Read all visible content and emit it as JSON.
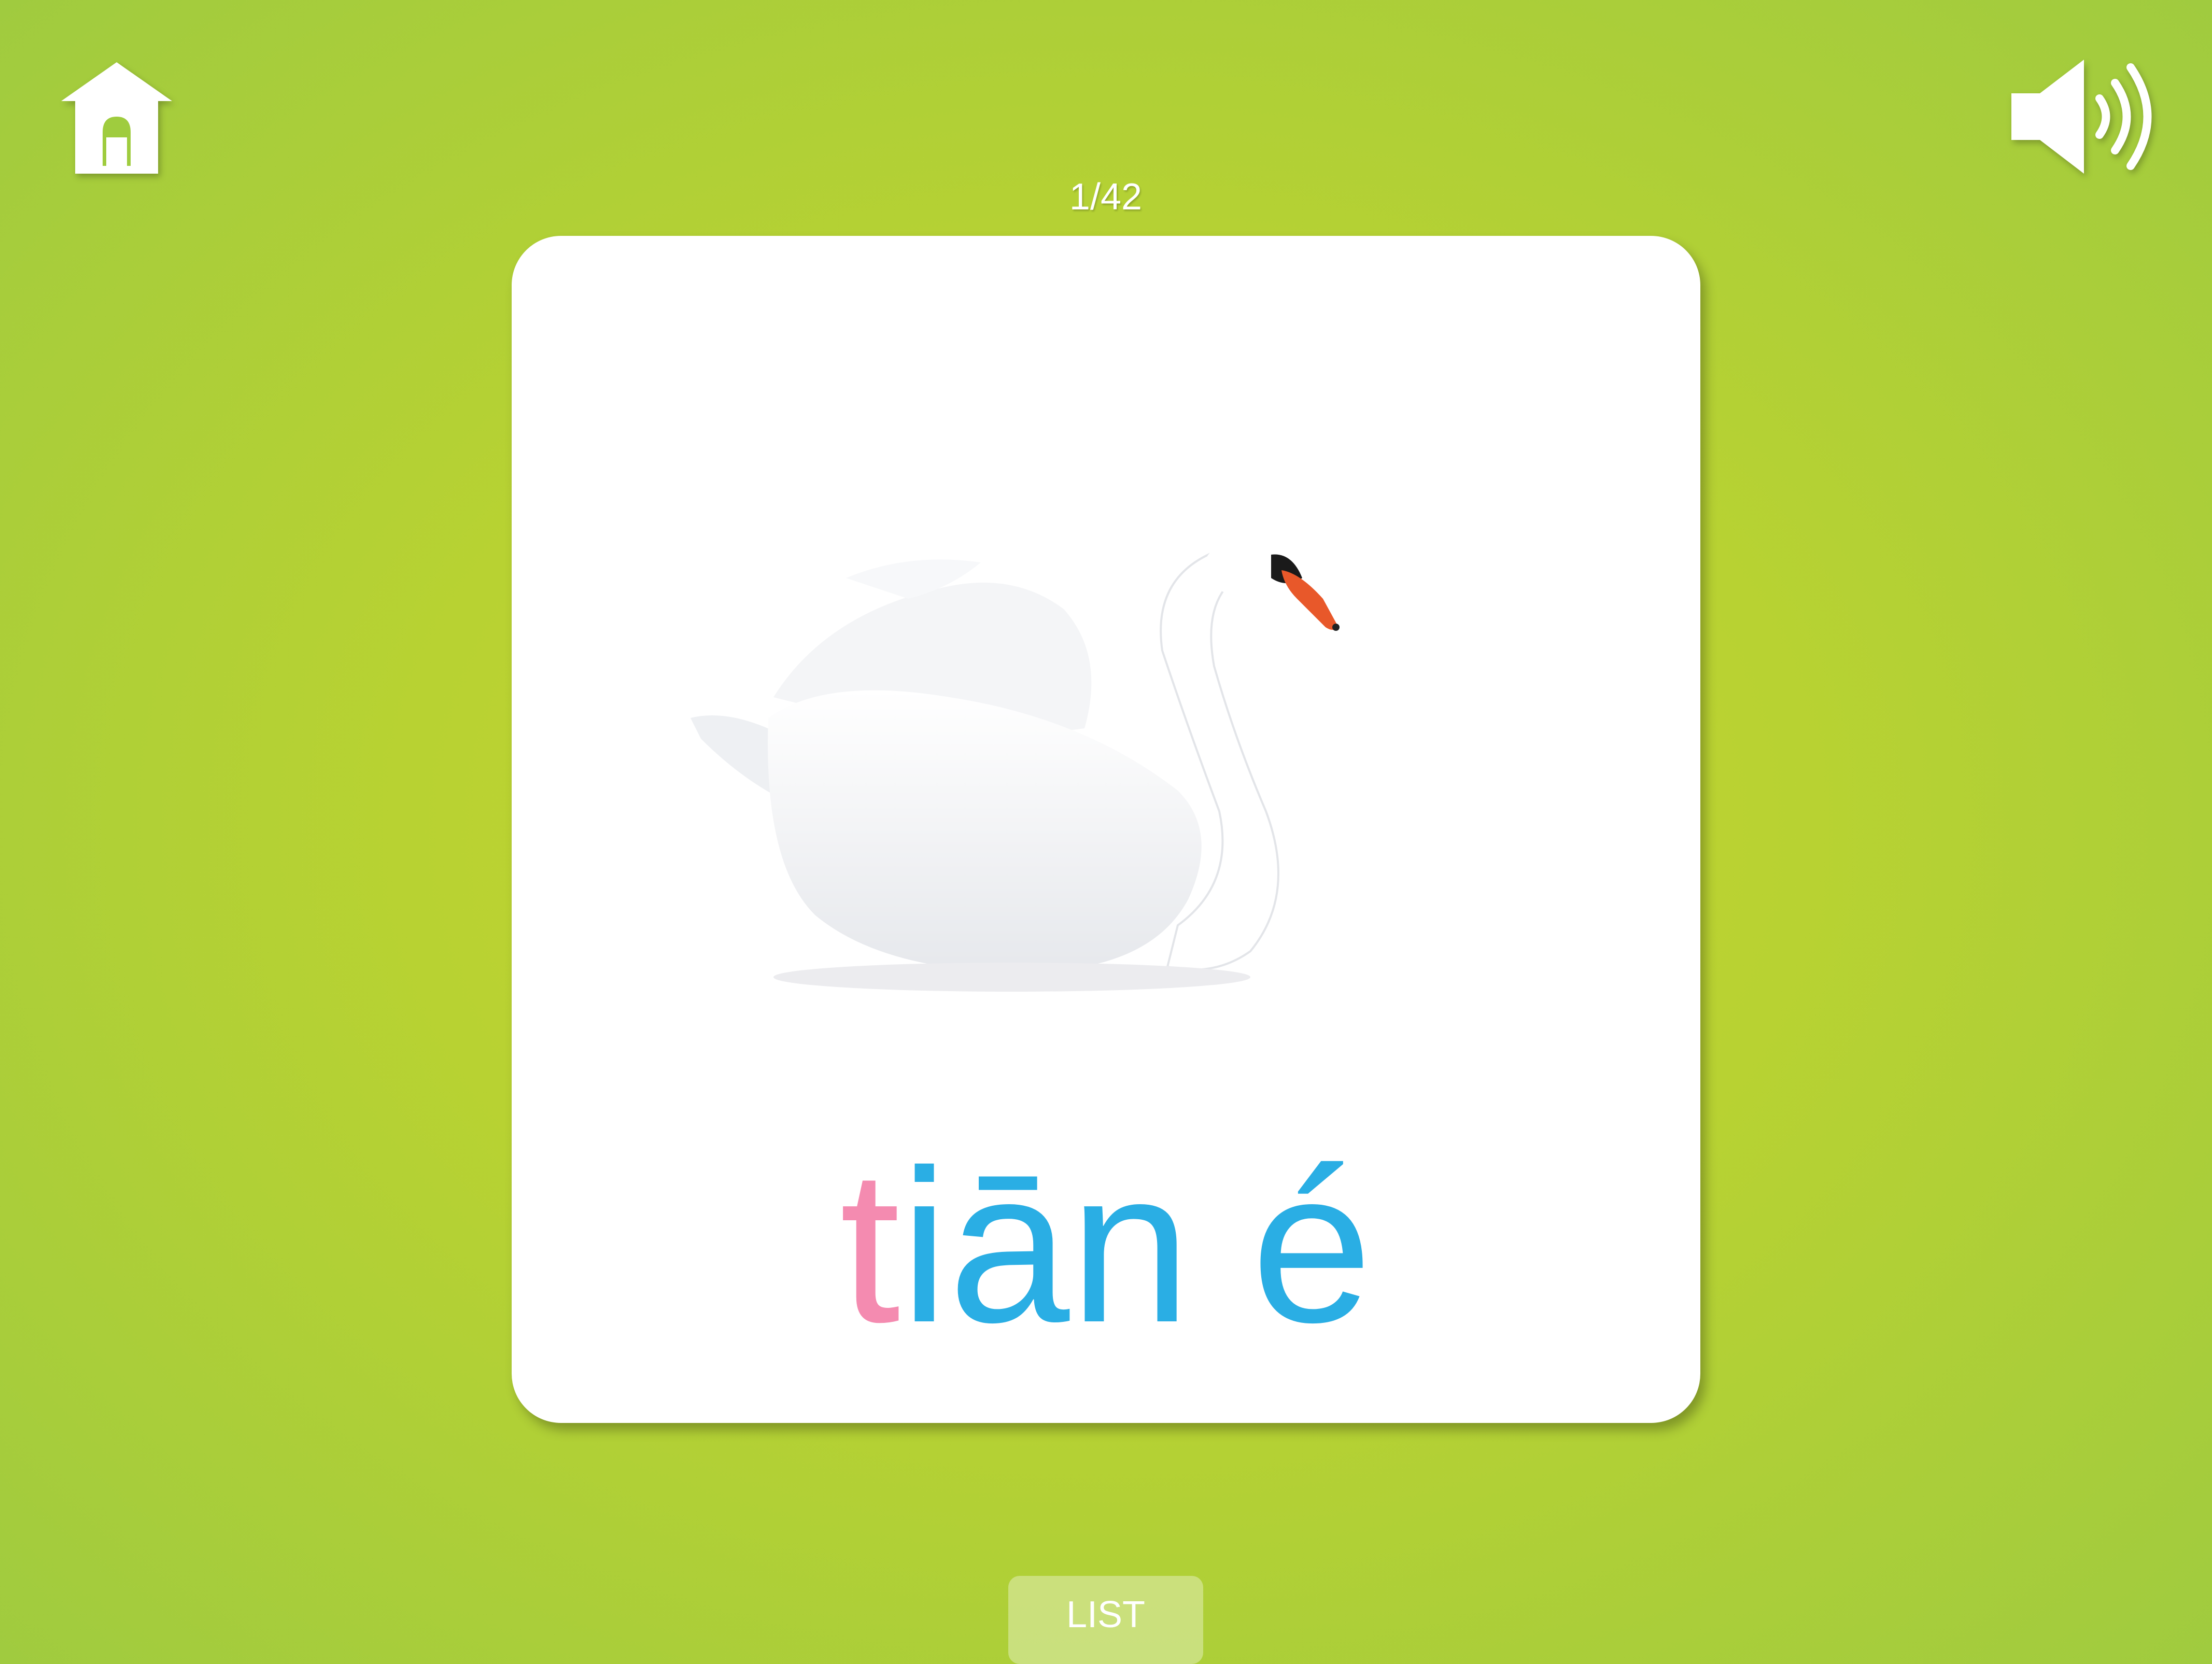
{
  "header": {
    "home_icon": "home-icon",
    "sound_icon": "speaker-icon",
    "counter": "1/42"
  },
  "card": {
    "image_subject": "swan",
    "pinyin_initial": "t",
    "pinyin_rest": "iān é",
    "colors": {
      "initial": "#f48bb0",
      "rest": "#2aaee4"
    }
  },
  "footer": {
    "list_label": "LIST"
  },
  "colors": {
    "background": "#b8d232",
    "card": "#ffffff"
  }
}
